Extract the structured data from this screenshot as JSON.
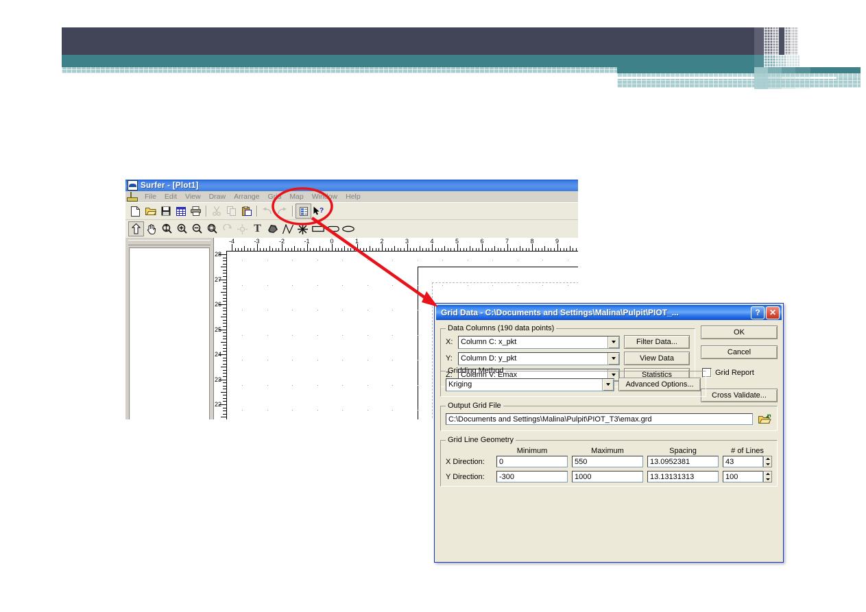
{
  "slide": {
    "banner": {
      "dark_color": "#424458",
      "teal_color": "#3f8189",
      "hatch_color": "#a9cdcf"
    }
  },
  "annotation": {
    "color": "#e8131a",
    "ellipse_target": "Grid menu",
    "arrow_target": "Grid Data dialog title bar"
  },
  "surfer": {
    "title": "Surfer - [Plot1]",
    "menus": [
      "File",
      "Edit",
      "View",
      "Draw",
      "Arrange",
      "Grid",
      "Map",
      "Window",
      "Help"
    ],
    "toolbar_main": [
      {
        "name": "new-icon",
        "glyph": "⬜"
      },
      {
        "name": "open-icon",
        "glyph": "📂"
      },
      {
        "name": "save-icon",
        "glyph": "💾"
      },
      {
        "name": "worksheet-icon",
        "glyph": "▦"
      },
      {
        "name": "print-icon",
        "glyph": "🖨"
      },
      {
        "name": "cut-icon",
        "glyph": "✂"
      },
      {
        "name": "copy-icon",
        "glyph": "⧉"
      },
      {
        "name": "paste-icon",
        "glyph": "📋"
      },
      {
        "name": "undo-icon",
        "glyph": "↶"
      },
      {
        "name": "redo-icon",
        "glyph": "↷"
      },
      {
        "name": "properties-icon",
        "glyph": "☰"
      },
      {
        "name": "context-help-icon",
        "glyph": "?"
      }
    ],
    "toolbar_draw": [
      {
        "name": "select-arrow-icon",
        "glyph": "⇧"
      },
      {
        "name": "pan-hand-icon",
        "glyph": "✋"
      },
      {
        "name": "zoom-icon",
        "glyph": "🔍"
      },
      {
        "name": "zoom-in-icon",
        "glyph": "🔍"
      },
      {
        "name": "zoom-out-icon",
        "glyph": "🔍"
      },
      {
        "name": "zoom-selection-icon",
        "glyph": "🔍"
      },
      {
        "name": "rotate-icon",
        "glyph": "↻"
      },
      {
        "name": "reshape-icon",
        "glyph": "✥"
      },
      {
        "name": "text-tool-icon",
        "glyph": "T"
      },
      {
        "name": "polygon-tool-icon",
        "glyph": "⬟"
      },
      {
        "name": "polyline-tool-icon",
        "glyph": "∧"
      },
      {
        "name": "symbol-tool-icon",
        "glyph": "✻"
      },
      {
        "name": "rectangle-tool-icon",
        "glyph": "▭"
      },
      {
        "name": "rounded-rect-tool-icon",
        "glyph": "▭"
      },
      {
        "name": "ellipse-tool-icon",
        "glyph": "⬭"
      }
    ],
    "ruler_h_labels": [
      "-4",
      "-3",
      "-2",
      "-1",
      "0",
      "1",
      "2",
      "3",
      "4",
      "5",
      "6",
      "7",
      "8",
      "9"
    ],
    "ruler_v_labels": [
      "28",
      "27",
      "26",
      "25",
      "24",
      "23",
      "22"
    ]
  },
  "dialog": {
    "title": "Grid Data - C:\\Documents and Settings\\Malina\\Pulpit\\PIOT_...",
    "help_button": "?",
    "close_button": "✕",
    "data_columns": {
      "legend": "Data Columns    (190 data points)",
      "rows": [
        {
          "label": "X:",
          "value": "Column C:  x_pkt",
          "button": "Filter Data..."
        },
        {
          "label": "Y:",
          "value": "Column D:  y_pkt",
          "button": "View Data"
        },
        {
          "label": "Z:",
          "value": "Column V:  Emax",
          "button": "Statistics"
        }
      ]
    },
    "gridding_method": {
      "legend": "Gridding Method",
      "value": "Kriging",
      "advanced_button": "Advanced Options..."
    },
    "output_grid_file": {
      "legend": "Output Grid File",
      "value": "C:\\Documents and Settings\\Malina\\Pulpit\\PIOT_T3\\emax.grd"
    },
    "grid_line_geometry": {
      "legend": "Grid Line Geometry",
      "headers": [
        "Minimum",
        "Maximum",
        "Spacing",
        "# of Lines"
      ],
      "rows": [
        {
          "label": "X Direction:",
          "minimum": "0",
          "maximum": "550",
          "spacing": "13.0952381",
          "lines": "43"
        },
        {
          "label": "Y Direction:",
          "minimum": "-300",
          "maximum": "1000",
          "spacing": "13.13131313",
          "lines": "100"
        }
      ]
    },
    "side_buttons": {
      "ok": "OK",
      "cancel": "Cancel",
      "grid_report": "Grid Report",
      "grid_report_checked": false,
      "cross_validate": "Cross Validate..."
    }
  }
}
